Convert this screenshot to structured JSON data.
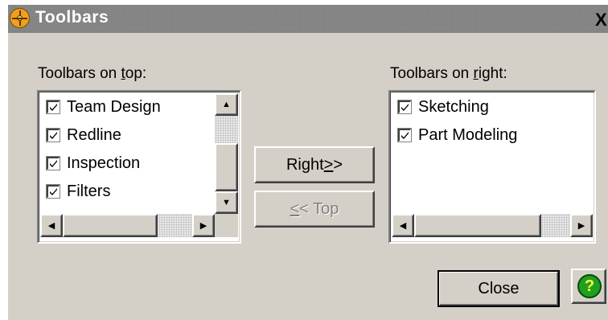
{
  "window": {
    "title": "Toolbars",
    "close_glyph": "X"
  },
  "left_panel": {
    "label_pre": "Toolbars on ",
    "label_hot": "t",
    "label_post": "op:",
    "items": [
      {
        "label": "Team Design",
        "checked": true
      },
      {
        "label": "Redline",
        "checked": true
      },
      {
        "label": "Inspection",
        "checked": true
      },
      {
        "label": "Filters",
        "checked": true
      }
    ]
  },
  "right_panel": {
    "label_pre": "Toolbars on ",
    "label_hot": "r",
    "label_post": "ight:",
    "items": [
      {
        "label": "Sketching",
        "checked": true
      },
      {
        "label": "Part Modeling",
        "checked": true
      }
    ]
  },
  "buttons": {
    "right": {
      "pre": "Right ",
      "hot": ">",
      "post": ">",
      "enabled": true
    },
    "top": {
      "pre": "",
      "hot": "<",
      "post": "< Top",
      "enabled": false
    },
    "close": "Close",
    "help": "?"
  },
  "icons": [
    "app-logo-icon",
    "close-icon",
    "checkbox-check-icon",
    "scroll-up-icon",
    "scroll-down-icon",
    "scroll-left-icon",
    "scroll-right-icon",
    "help-icon"
  ],
  "colors": {
    "dialog_bg": "#d4d0c8",
    "titlebar_bg": "#808080",
    "help_green": "#20a020"
  }
}
